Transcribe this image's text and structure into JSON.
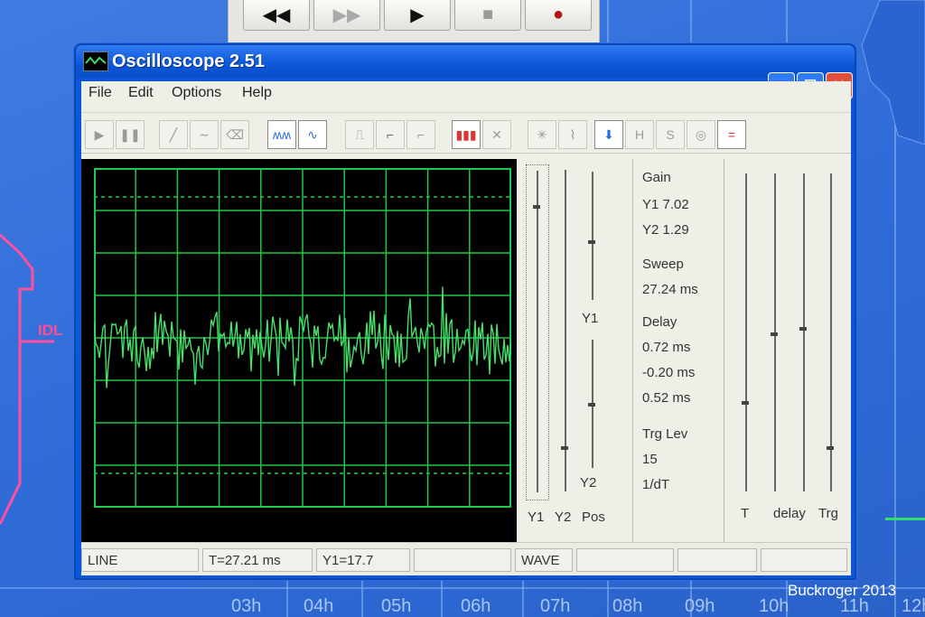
{
  "window": {
    "title": "Oscilloscope 2.51"
  },
  "menu": [
    "File",
    "Edit",
    "Options",
    "Help"
  ],
  "gain": {
    "heading": "Gain",
    "y1": "Y1  7.02",
    "y2": "Y2  1.29"
  },
  "sweep": {
    "heading": "Sweep",
    "value": "27.24 ms"
  },
  "delay": {
    "heading": "Delay",
    "values": [
      "0.72 ms",
      "-0.20 ms",
      "0.52 ms"
    ]
  },
  "trigger": {
    "heading": "Trg Lev",
    "value": "15",
    "freq_label": "1/dT"
  },
  "slider_labels": {
    "y1_mid": "Y1",
    "y2_mid": "Y2",
    "bottom": [
      "Y1",
      "Y2",
      "Pos"
    ],
    "right": [
      "T",
      "delay",
      "Trg"
    ]
  },
  "status": {
    "mode": "LINE",
    "time": "T=27.21 ms",
    "y1": "Y1=17.7",
    "wave": "WAVE"
  },
  "background": {
    "idl_label": "IDL",
    "time_labels": [
      "03h",
      "04h",
      "05h",
      "06h",
      "07h",
      "08h",
      "09h",
      "10h",
      "11h",
      "12h"
    ],
    "credit": "Buckroger 2013"
  },
  "colors": {
    "trace": "#45e06a",
    "grid": "#1fc84a",
    "title_bar": "#0b57d8",
    "close_button": "#e0503a"
  }
}
